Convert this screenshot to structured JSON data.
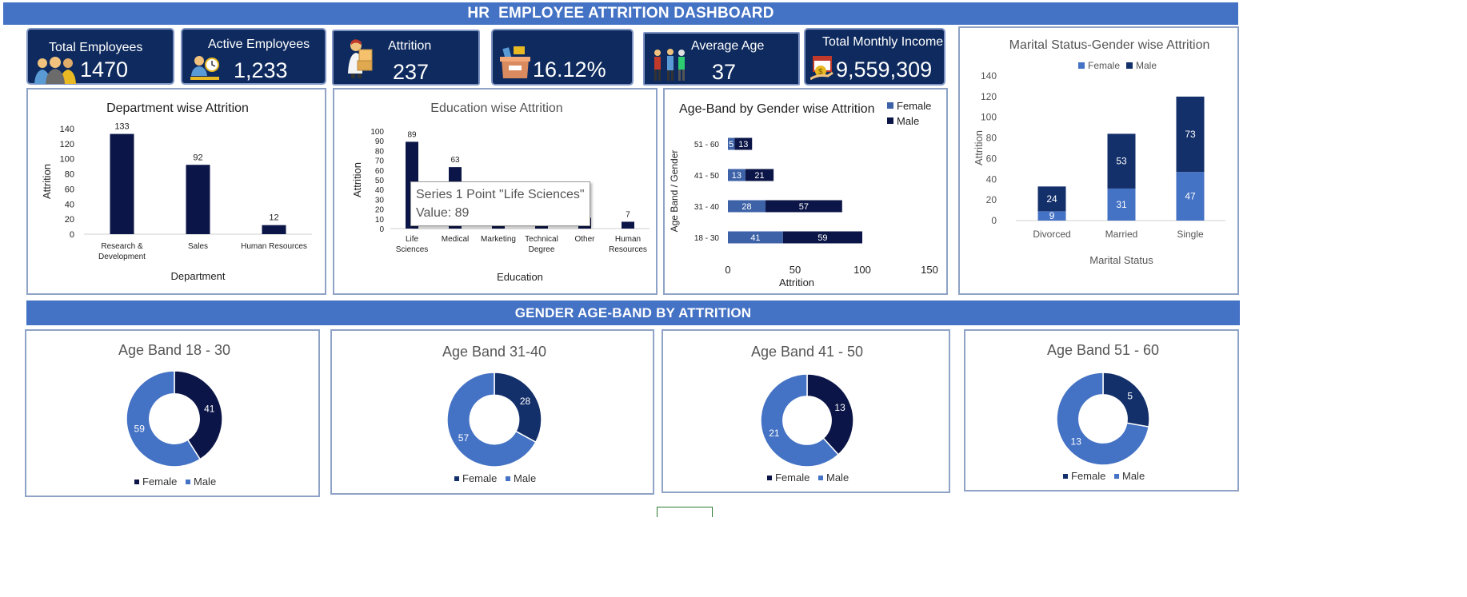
{
  "header": {
    "title": "HR  EMPLOYEE ATTRITION DASHBOARD"
  },
  "kpis": {
    "total_employees": {
      "label": "Total Employees",
      "value": "1470"
    },
    "active_employees": {
      "label": "Active Employees",
      "value": "1,233"
    },
    "attrition": {
      "label": "Attrition",
      "value": "237"
    },
    "attrition_rate": {
      "value": "16.12%"
    },
    "average_age": {
      "label": "Average Age",
      "value": "37"
    },
    "total_monthly_income": {
      "label": "Total Monthly Income",
      "value": "9,559,309"
    }
  },
  "colors": {
    "dark_navy": "#0b1547",
    "navy": "#13306b",
    "blue": "#4472c4",
    "banner": "#4472c4",
    "kpi_bg": "#0e2a5e"
  },
  "section2": {
    "title": "GENDER AGE-BAND BY ATTRITION"
  },
  "tooltip": {
    "line1": "Series 1 Point \"Life Sciences\"",
    "line2": "Value: 89"
  },
  "chart_data": [
    {
      "id": "dept",
      "type": "bar",
      "title": "Department wise  Attrition",
      "categories": [
        "Research & Development",
        "Sales",
        "Human Resources"
      ],
      "category_lines": [
        [
          "Research &",
          "Development"
        ],
        [
          "Sales"
        ],
        [
          "Human Resources"
        ]
      ],
      "values": [
        133,
        92,
        12
      ],
      "xlabel": "Department",
      "ylabel": "Attrition",
      "ylim": [
        0,
        140
      ],
      "yticks": [
        0,
        20,
        40,
        60,
        80,
        100,
        120,
        140
      ],
      "color": "#0b1547"
    },
    {
      "id": "edu",
      "type": "bar",
      "title": "Education wise Attrition",
      "categories": [
        "Life Sciences",
        "Medical",
        "Marketing",
        "Technical Degree",
        "Other",
        "Human Resources"
      ],
      "category_lines": [
        [
          "Life",
          "Sciences"
        ],
        [
          "Medical"
        ],
        [
          "Marketing"
        ],
        [
          "Technical",
          "Degree"
        ],
        [
          "Other"
        ],
        [
          "Human",
          "Resources"
        ]
      ],
      "values": [
        89,
        63,
        35,
        32,
        11,
        7
      ],
      "xlabel": "Education",
      "ylabel": "Attrition",
      "ylim": [
        0,
        100
      ],
      "yticks": [
        0,
        10,
        20,
        30,
        40,
        50,
        60,
        70,
        80,
        90,
        100
      ],
      "color": "#0b1547"
    },
    {
      "id": "ageband",
      "type": "bar",
      "orientation": "horizontal",
      "stacked": true,
      "title": "Age-Band by Gender wise Attrition",
      "categories": [
        "18 - 30",
        "31 - 40",
        "41 - 50",
        "51 - 60"
      ],
      "series": [
        {
          "name": "Female",
          "values": [
            41,
            28,
            13,
            5
          ],
          "color": "#3d62a8"
        },
        {
          "name": "Male",
          "values": [
            59,
            57,
            21,
            13
          ],
          "color": "#0b1547"
        }
      ],
      "xlabel": "Attrition",
      "ylabel": "Age Band / Gender",
      "xlim": [
        0,
        150
      ],
      "xticks": [
        0,
        50,
        100,
        150
      ],
      "legend": "top-right"
    },
    {
      "id": "marital",
      "type": "bar",
      "stacked": true,
      "title": "Marital Status-Gender wise Attrition",
      "categories": [
        "Divorced",
        "Married",
        "Single"
      ],
      "series": [
        {
          "name": "Female",
          "values": [
            9,
            31,
            47
          ],
          "color": "#4472c4"
        },
        {
          "name": "Male",
          "values": [
            24,
            53,
            73
          ],
          "color": "#13306b"
        }
      ],
      "xlabel": "Marital Status",
      "ylabel": "Attrition",
      "ylim": [
        0,
        140
      ],
      "yticks": [
        0,
        20,
        40,
        60,
        80,
        100,
        120,
        140
      ],
      "legend": "top"
    },
    {
      "id": "d1830",
      "type": "pie",
      "donut": true,
      "title": "Age Band 18 - 30",
      "series": [
        {
          "name": "Female",
          "value": 41,
          "color": "#0b1547"
        },
        {
          "name": "Male",
          "value": 59,
          "color": "#4472c4"
        }
      ],
      "legend": "bottom"
    },
    {
      "id": "d3140",
      "type": "pie",
      "donut": true,
      "title": "Age Band 31-40",
      "series": [
        {
          "name": "Female",
          "value": 28,
          "color": "#13306b"
        },
        {
          "name": "Male",
          "value": 57,
          "color": "#4472c4"
        }
      ],
      "legend": "bottom"
    },
    {
      "id": "d4150",
      "type": "pie",
      "donut": true,
      "title": "Age Band 41 - 50",
      "series": [
        {
          "name": "Female",
          "value": 13,
          "color": "#0b1547"
        },
        {
          "name": "Male",
          "value": 21,
          "color": "#4472c4"
        }
      ],
      "legend": "bottom"
    },
    {
      "id": "d5160",
      "type": "pie",
      "donut": true,
      "title": "Age Band 51 - 60",
      "series": [
        {
          "name": "Female",
          "value": 5,
          "color": "#13306b"
        },
        {
          "name": "Male",
          "value": 13,
          "color": "#4472c4"
        }
      ],
      "legend": "bottom"
    }
  ]
}
